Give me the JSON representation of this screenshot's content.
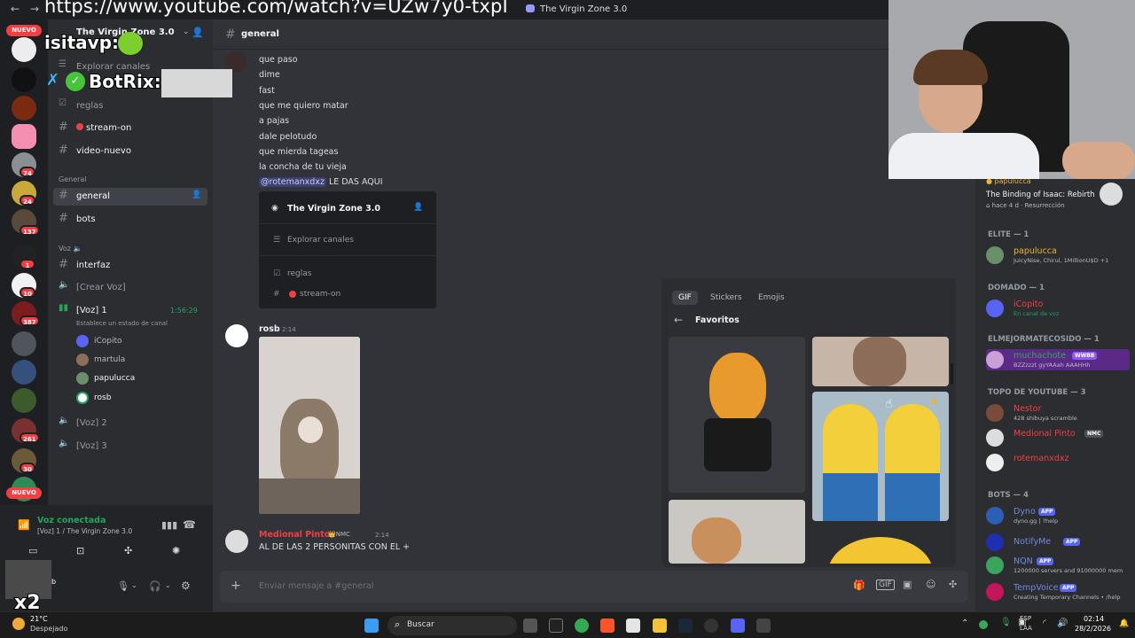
{
  "browser": {
    "url": "https://www.youtube.com/watch?v=UZw7y0-txpI",
    "window_title": "The Virgin Zone 3.0"
  },
  "overlay": {
    "username": "isitavp:",
    "bot": "BotRix:",
    "multiplier": "x2"
  },
  "guilds": {
    "nuevo_label": "NUEVO",
    "badges": [
      "74",
      "24",
      "137",
      "1",
      "10",
      "387",
      "261",
      "30"
    ]
  },
  "server": {
    "name": "The Virgin Zone 3.0",
    "explore": "Explorar canales",
    "channels_top": [
      "reglas",
      "stream-on",
      "video-nuevo"
    ],
    "category_general": "General",
    "channels_general": [
      "general",
      "bots"
    ],
    "category_voz": "Voz",
    "channels_voz": [
      "interfaz",
      "[Crear Voz]",
      "[Voz] 1"
    ],
    "voice_timer": "1:56:29",
    "voice_status": "Establece un estado de canal",
    "voice_users": [
      "iCopito",
      "martula",
      "papulucca",
      "rosb"
    ],
    "more_voice": [
      "[Voz] 2",
      "[Voz] 3"
    ]
  },
  "voice_panel": {
    "status": "Voz conectada",
    "location": "[Voz] 1 / The Virgin Zone 3.0"
  },
  "weather": {
    "temp": "21°C",
    "desc": "Despejado"
  },
  "chat": {
    "channel": "general",
    "lines": [
      "que paso",
      "dime",
      "fast",
      "que me quiero matar",
      "a pajas",
      "dale pelotudo",
      "que mierda tageas",
      "la concha de tu vieja"
    ],
    "mention": "@rotemanxdxz",
    "mention_text": " LE DAS AQUI",
    "embed": {
      "server": "The Virgin Zone 3.0",
      "explore": "Explorar canales",
      "ch1": "reglas",
      "ch2": "stream-on"
    },
    "msg2_author": "rosb",
    "msg2_time": "2:14",
    "msg3_author": "Medional Pinto",
    "msg3_tag": "NMC",
    "msg3_time": "2:14",
    "msg3_text": "AL DE LAS 2 PERSONITAS CON EL +",
    "composer_placeholder": "Enviar mensaje a #general"
  },
  "gif_picker": {
    "tabs": [
      "GIF",
      "Stickers",
      "Emojis"
    ],
    "section": "Favoritos"
  },
  "activity": {
    "user": "papulucca",
    "game": "The Binding of Isaac: Rebirth",
    "meta": "hace 4 d",
    "meta2": "Resurrección"
  },
  "members": [
    {
      "cat": "ELITE — 1",
      "name": "papulucca",
      "sub": "JuicyNise, Chirul, 1MillionU$D +1",
      "color": "#f0b232"
    },
    {
      "cat": "DOMADO — 1",
      "name": "iCopito",
      "sub": "En canal de voz",
      "color": "#f23f43"
    },
    {
      "cat": "ELMEJORMATECOSIDO — 1",
      "name": "muchachote",
      "sub": "BZZzzzt gyYAAah AAAHHh",
      "color": "#3ba55d",
      "tag": "WWBB"
    },
    {
      "cat": "TOPO DE YOUTUBE — 3",
      "name": "Nestor",
      "sub": "428 shibuya scramble",
      "color": "#f23f43"
    },
    {
      "cat": "",
      "name": "Medional Pinto",
      "sub": "",
      "color": "#f23f43",
      "tag": "NMC"
    },
    {
      "cat": "",
      "name": "rotemanxdxz",
      "sub": "",
      "color": "#f23f43"
    },
    {
      "cat": "BOTS — 4",
      "name": "Dyno",
      "sub": "dyno.gg | ?help",
      "color": "#5865f2",
      "tag": "APP"
    },
    {
      "cat": "",
      "name": "NotifyMe",
      "sub": "",
      "color": "#5865f2",
      "tag": "APP"
    },
    {
      "cat": "",
      "name": "NQN",
      "sub": "1200000 servers and 91000000 mem",
      "color": "#5865f2",
      "tag": "APP"
    },
    {
      "cat": "",
      "name": "TempVoice",
      "sub": "Creating Temporary Channels • /help",
      "color": "#5865f2",
      "tag": "APP"
    }
  ],
  "taskbar": {
    "search": "Buscar",
    "lang1": "ESP",
    "lang2": "LAA",
    "time": "02:14",
    "date": "28/2/2026"
  }
}
